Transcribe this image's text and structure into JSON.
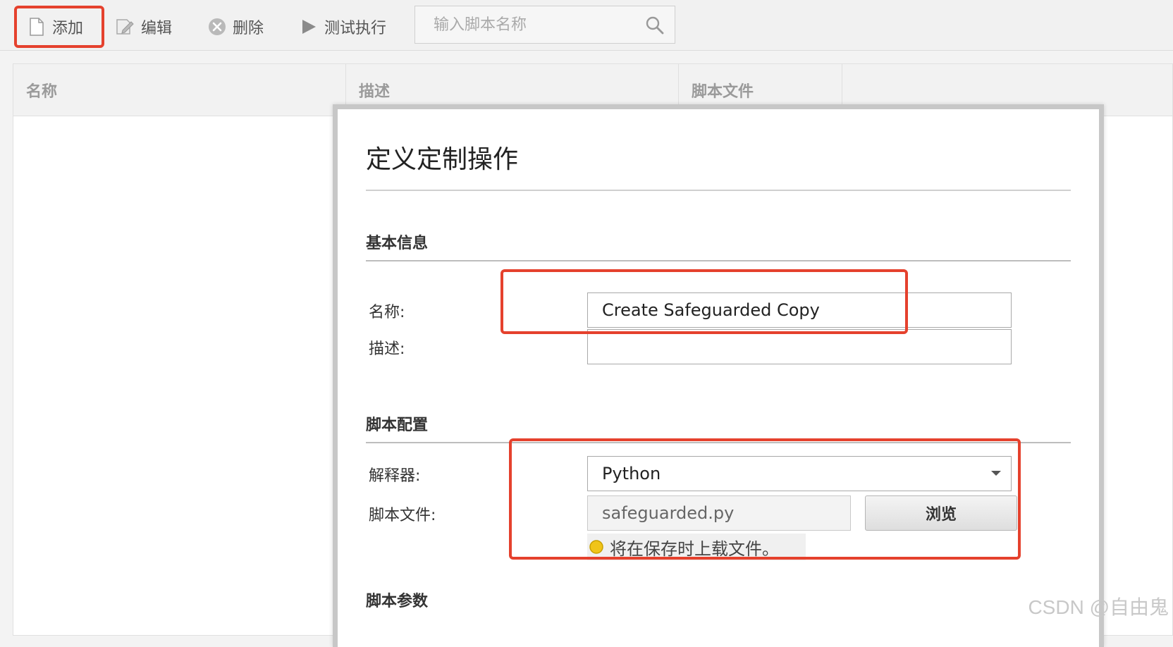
{
  "toolbar": {
    "add_label": "添加",
    "edit_label": "编辑",
    "delete_label": "删除",
    "run_label": "测试执行",
    "search_placeholder": "输入脚本名称"
  },
  "table": {
    "columns": [
      "名称",
      "描述",
      "脚本文件"
    ]
  },
  "dialog": {
    "title": "定义定制操作",
    "basic_section": "基本信息",
    "name_label": "名称:",
    "name_value": "Create Safeguarded Copy",
    "desc_label": "描述:",
    "desc_value": "",
    "script_section": "脚本配置",
    "interpreter_label": "解释器:",
    "interpreter_value": "Python",
    "file_label": "脚本文件:",
    "file_value": "safeguarded.py",
    "browse_label": "浏览",
    "notice": "将在保存时上载文件。",
    "params_section": "脚本参数"
  },
  "watermark": "CSDN @自由鬼",
  "colors": {
    "highlight": "#e5412d",
    "notice_dot": "#f0c419"
  }
}
